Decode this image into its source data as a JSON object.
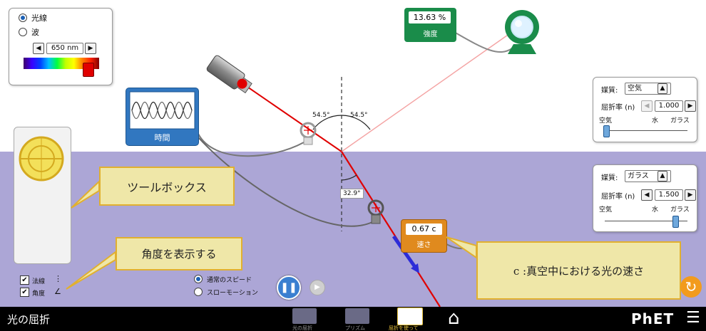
{
  "app": {
    "title": "光の屈折",
    "logo": "PhET"
  },
  "light_panel": {
    "mode_options": [
      {
        "label": "光線",
        "selected": true
      },
      {
        "label": "波",
        "selected": false
      }
    ],
    "wavelength_value": "650 nm",
    "slider_fraction": 0.9
  },
  "intensity_meter": {
    "value": "13.63 %",
    "label": "強度"
  },
  "time_sensor": {
    "label": "時間"
  },
  "angles": {
    "incident": "54.5°",
    "reflected": "54.5°",
    "refracted": "32.9°"
  },
  "speed_meter": {
    "value": "0.67 c",
    "label": "速さ"
  },
  "top_medium": {
    "medium_label": "媒質:",
    "medium_value": "空気",
    "index_label": "屈折率 (n)",
    "index_value": "1.000",
    "ticks": [
      "空気",
      "水",
      "ガラス"
    ],
    "slider_fraction": 0.0
  },
  "bottom_medium": {
    "medium_label": "媒質:",
    "medium_value": "ガラス",
    "index_label": "屈折率 (n)",
    "index_value": "1.500",
    "ticks": [
      "空気",
      "水",
      "ガラス"
    ],
    "slider_fraction": 0.82
  },
  "callouts": {
    "toolbox": "ツールボックス",
    "show_angle": "角度を表示する",
    "speed_note": "c :真空中における光の速さ"
  },
  "checkboxes": [
    {
      "label": "法線",
      "checked": true
    },
    {
      "label": "角度",
      "checked": true
    }
  ],
  "speed_options": [
    {
      "label": "通常のスピード",
      "selected": true
    },
    {
      "label": "スローモーション",
      "selected": false
    }
  ],
  "nav": {
    "screens": [
      "光の屈折",
      "プリズム",
      "屈折を使って"
    ]
  },
  "colors": {
    "laser": "#e00000",
    "water": "#aca6d6",
    "meter_green": "#1a8c4a",
    "time_blue": "#3177c0",
    "speed_orange": "#e08a1e",
    "callout_fill": "#efe7a8",
    "callout_border": "#e1b02f"
  }
}
